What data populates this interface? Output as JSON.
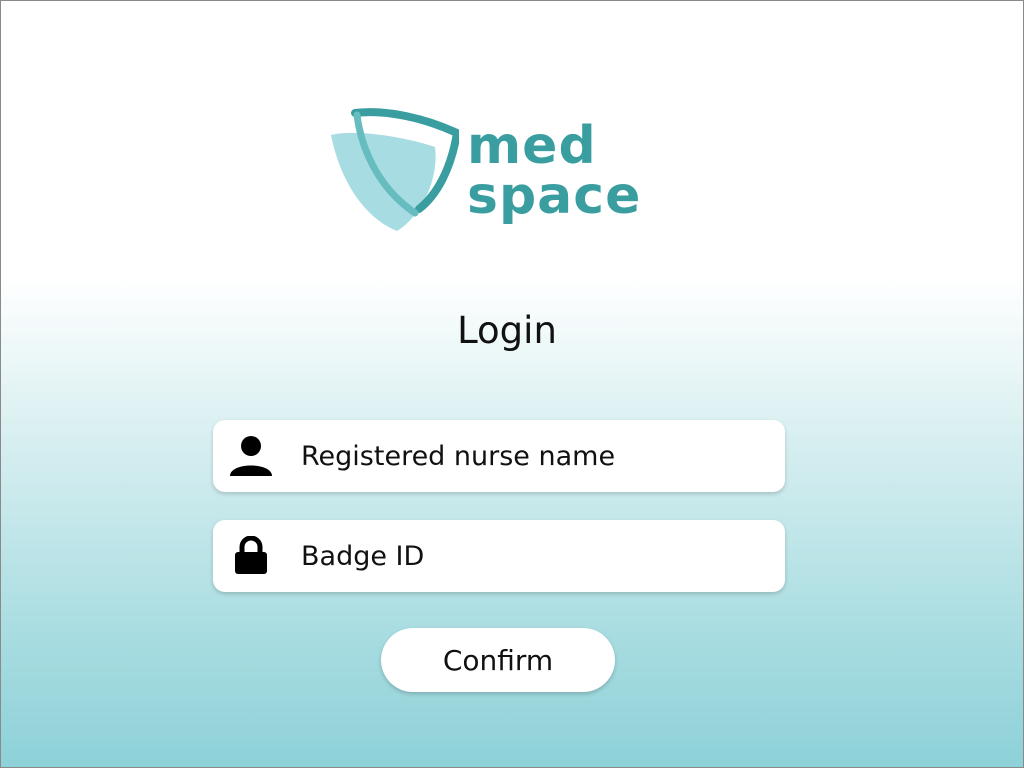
{
  "brand": {
    "line1": "med",
    "line2": "space",
    "color": "#3a9ea0",
    "icon": "shield-icon"
  },
  "login": {
    "title": "Login",
    "name_field": {
      "placeholder": "Registered nurse name",
      "icon": "user-icon"
    },
    "badge_field": {
      "placeholder": "Badge ID",
      "icon": "lock-icon"
    },
    "confirm_label": "Confirm"
  },
  "colors": {
    "gradient_bottom": "#8dd1d8",
    "accent": "#3a9ea0"
  }
}
